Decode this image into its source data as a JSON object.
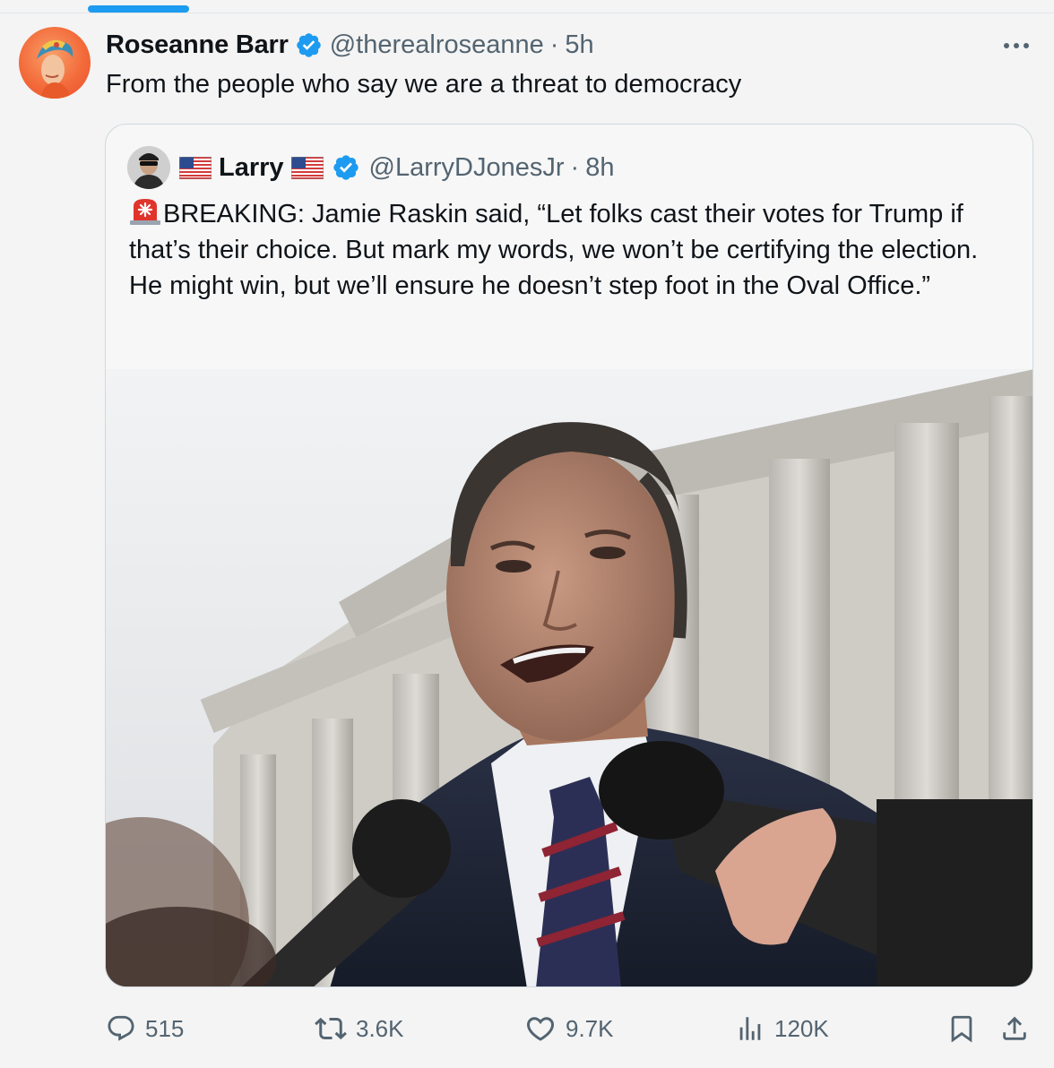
{
  "tweet": {
    "author": {
      "display_name": "Roseanne Barr",
      "handle": "@therealroseanne",
      "verified": true
    },
    "separator": "·",
    "time": "5h",
    "text": "From the people who say we are a threat to democracy"
  },
  "quoted_tweet": {
    "author": {
      "display_name": "Larry",
      "handle": "@LarryDJonesJr",
      "verified": true
    },
    "separator": "·",
    "time": "8h",
    "text": "BREAKING: Jamie Raskin said, “Let folks cast their votes for Trump if that’s their choice. But mark my words, we won’t be certifying the election. He might win, but we’ll ensure he doesn’t step foot in the Oval Office.”",
    "emoji_prefix": "police-car-light",
    "image": "photo"
  },
  "actions": {
    "replies": "515",
    "reposts": "3.6K",
    "likes": "9.7K",
    "views": "120K"
  },
  "colors": {
    "accent": "#1d9bf0",
    "text_primary": "#0f1419",
    "text_secondary": "#536471",
    "card_border": "#cfd9de",
    "background": "#f4f4f4"
  },
  "icons": {
    "reply": "reply-icon",
    "repost": "repost-icon",
    "like": "heart-icon",
    "views": "analytics-icon",
    "bookmark": "bookmark-icon",
    "share": "share-icon",
    "more": "more-icon",
    "verified": "verified-badge-icon",
    "flag": "us-flag-icon"
  }
}
